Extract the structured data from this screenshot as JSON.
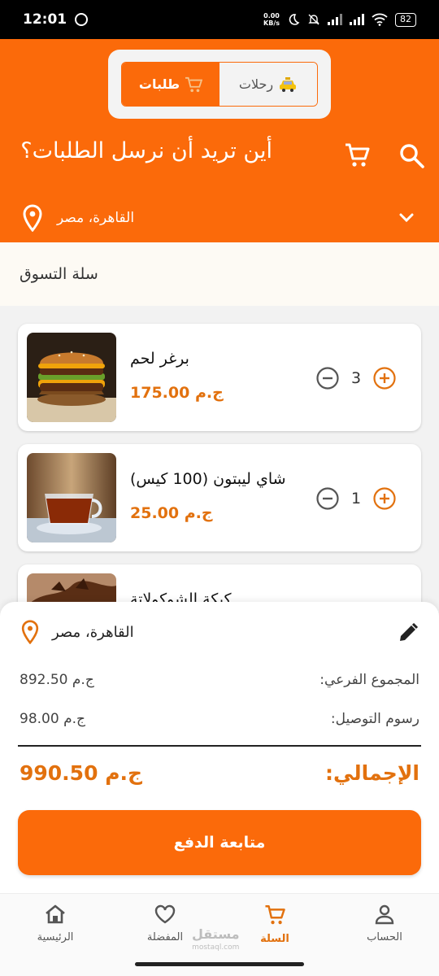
{
  "status_bar": {
    "time": "12:01",
    "net_speed_value": "0.00",
    "net_speed_unit": "KB/s",
    "battery": "82"
  },
  "header": {
    "tab_orders": "طلبات",
    "tab_trips": "رحلات",
    "title": "أين تريد أن نرسل الطلبات؟",
    "location": "القاهرة، مصر",
    "accent_color": "#fb6a0a"
  },
  "cart": {
    "section_title": "سلة التسوق",
    "items": [
      {
        "name": "برغر لحم",
        "price": "175.00 ج.م",
        "qty": "3"
      },
      {
        "name": "شاي ليبتون (100 كيس)",
        "price": "25.00 ج.م",
        "qty": "1"
      },
      {
        "name": "كيكة الشوكولاتة",
        "price": "",
        "qty": ""
      }
    ]
  },
  "summary": {
    "location": "القاهرة، مصر",
    "subtotal_label": ":المجموع الفرعي",
    "subtotal_value": "892.50 ج.م",
    "delivery_label": ":رسوم التوصيل",
    "delivery_value": "98.00 ج.م",
    "total_label": ":الإجمالي",
    "total_value": "990.50 ج.م",
    "checkout_label": "متابعة الدفع"
  },
  "bottom_nav": {
    "home": "الرئيسية",
    "favorites": "المفضلة",
    "cart": "السلة",
    "account": "الحساب",
    "watermark_main": "مستقل",
    "watermark_sub": "mostaql.com"
  }
}
